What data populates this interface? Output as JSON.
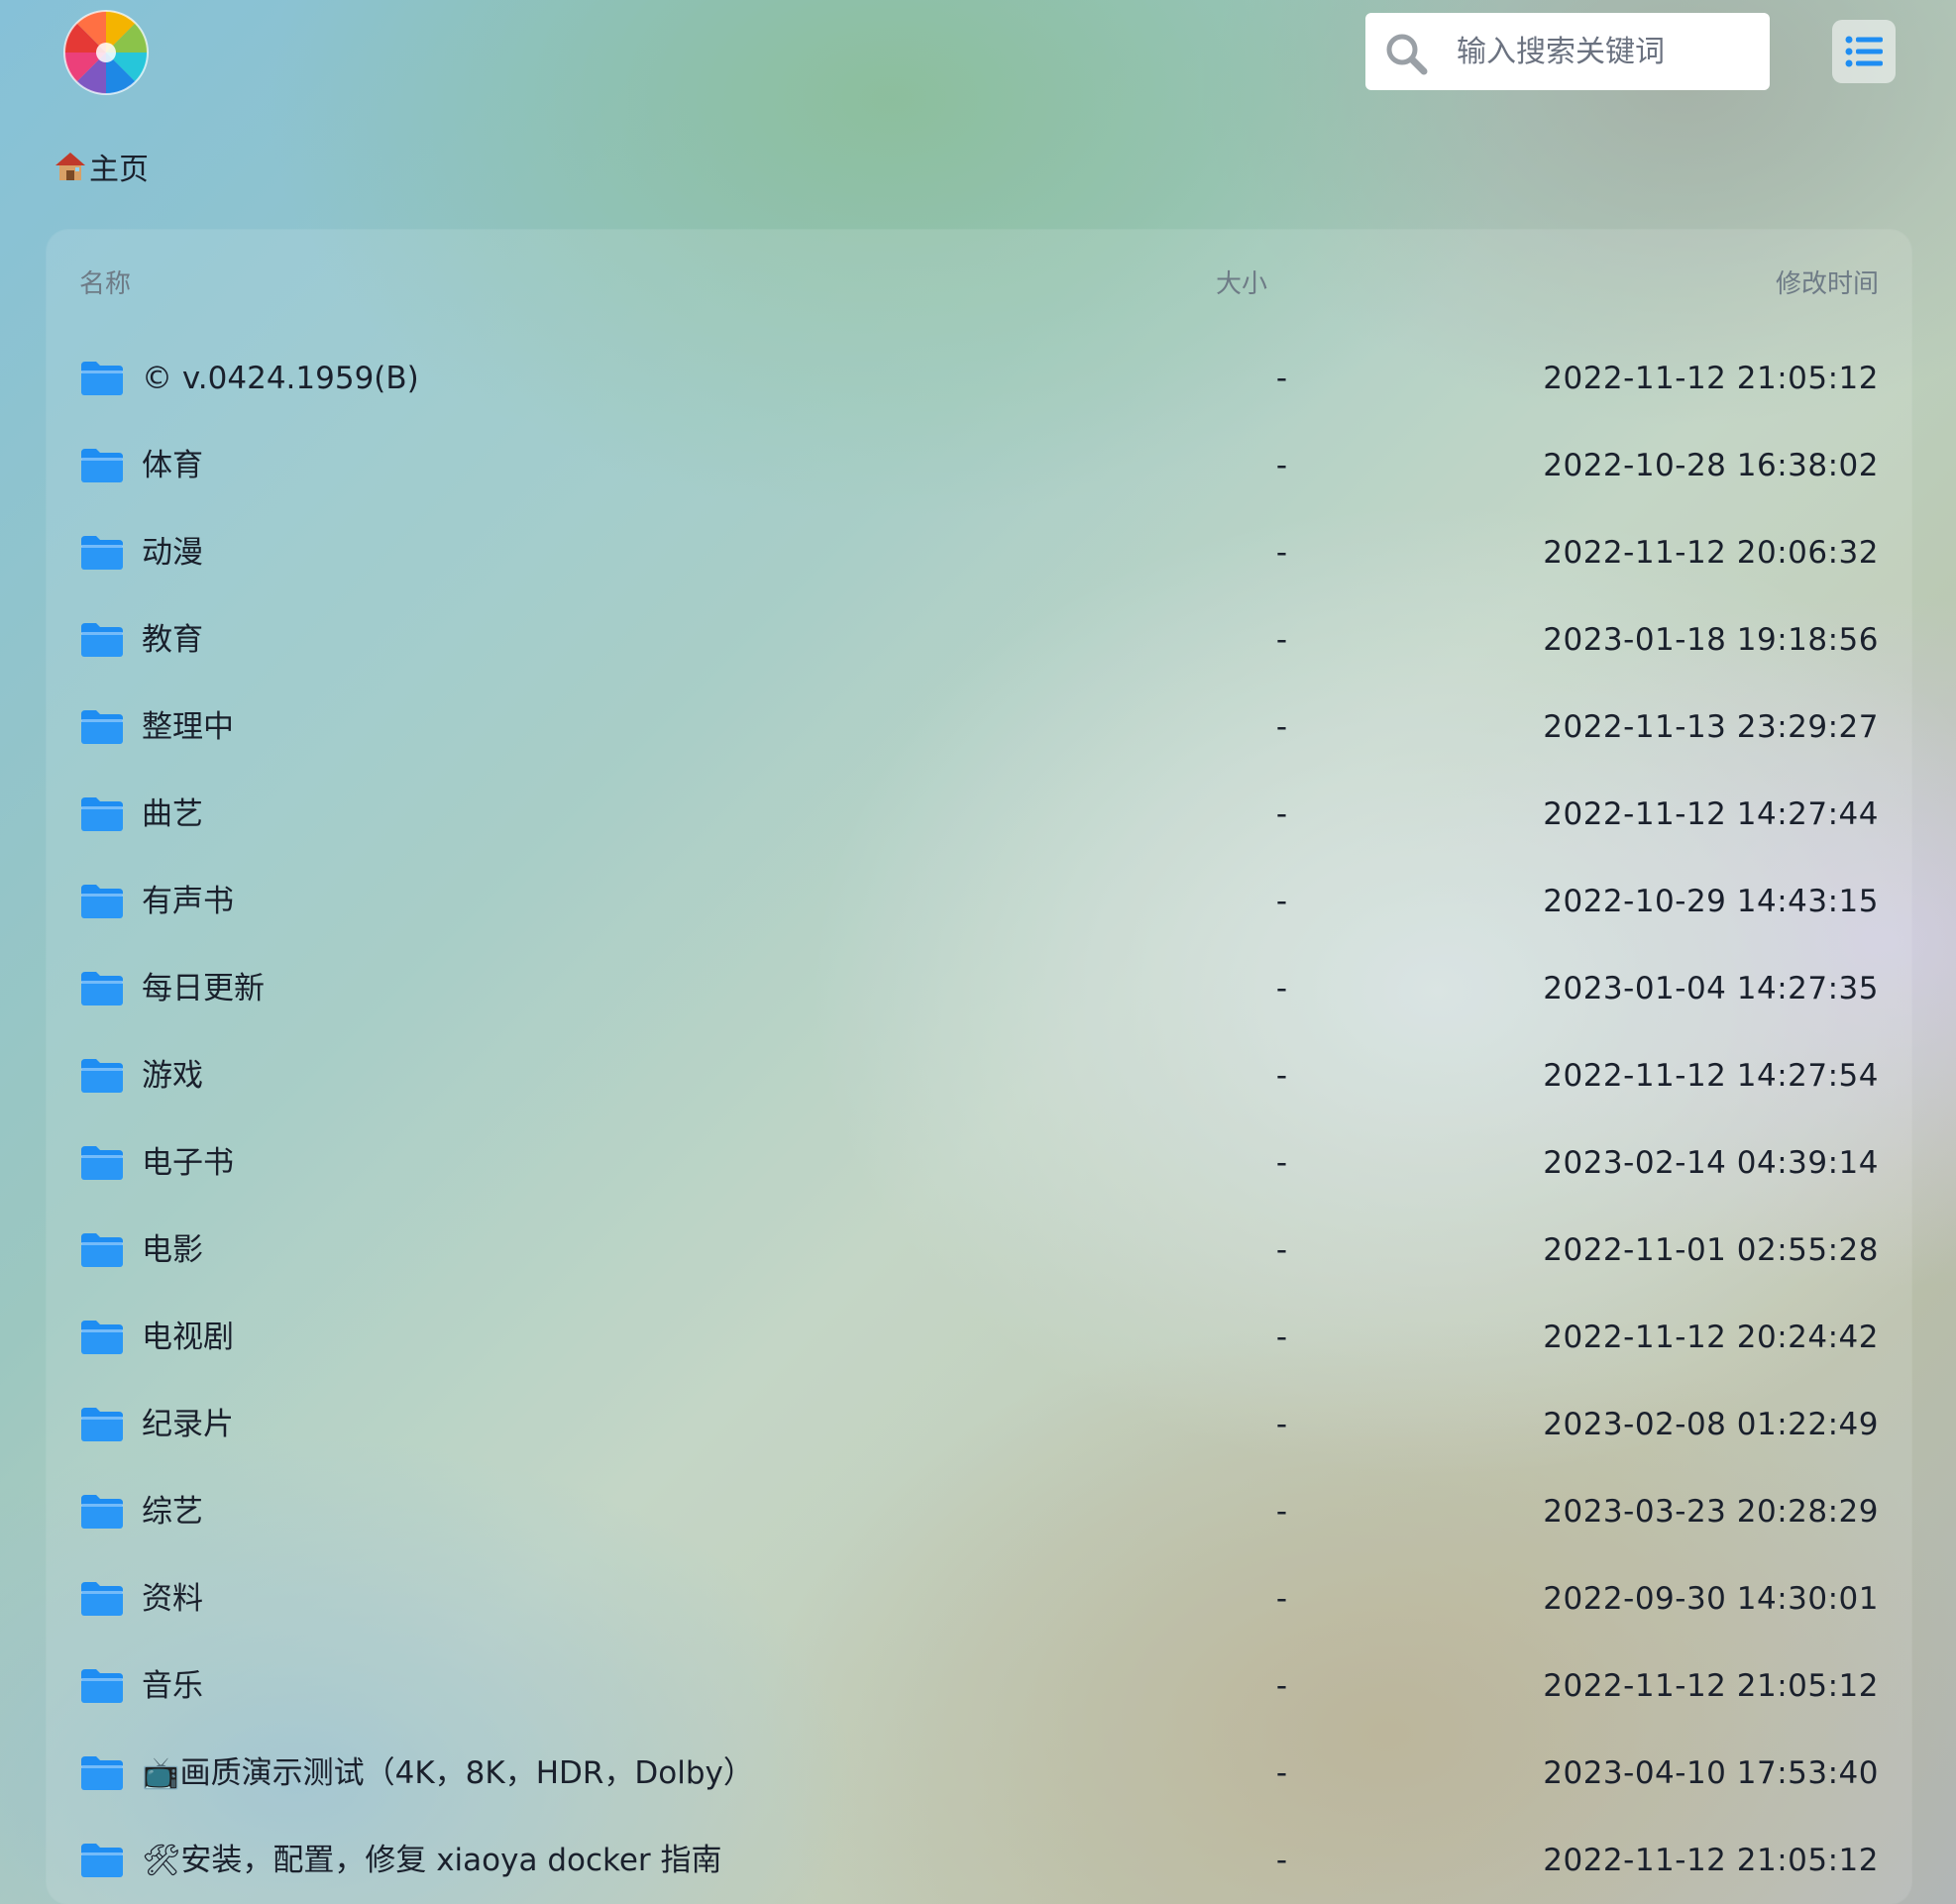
{
  "header": {
    "search": {
      "placeholder": "输入搜索关键词",
      "value": ""
    },
    "icons": {
      "logo": "color-wheel-logo",
      "search": "search-icon",
      "menu": "list-icon"
    },
    "colors": {
      "folder": "#1e8df2",
      "menu_icon": "#1e8df2"
    }
  },
  "breadcrumb": {
    "home_icon": "house-icon",
    "label": "主页"
  },
  "file_list": {
    "columns": {
      "name": "名称",
      "size": "大小",
      "modified": "修改时间"
    },
    "rows": [
      {
        "name": "© v.0424.1959(B)",
        "size": "-",
        "modified": "2022-11-12 21:05:12"
      },
      {
        "name": "体育",
        "size": "-",
        "modified": "2022-10-28 16:38:02"
      },
      {
        "name": "动漫",
        "size": "-",
        "modified": "2022-11-12 20:06:32"
      },
      {
        "name": "教育",
        "size": "-",
        "modified": "2023-01-18 19:18:56"
      },
      {
        "name": "整理中",
        "size": "-",
        "modified": "2022-11-13 23:29:27"
      },
      {
        "name": "曲艺",
        "size": "-",
        "modified": "2022-11-12 14:27:44"
      },
      {
        "name": "有声书",
        "size": "-",
        "modified": "2022-10-29 14:43:15"
      },
      {
        "name": "每日更新",
        "size": "-",
        "modified": "2023-01-04 14:27:35"
      },
      {
        "name": "游戏",
        "size": "-",
        "modified": "2022-11-12 14:27:54"
      },
      {
        "name": "电子书",
        "size": "-",
        "modified": "2023-02-14 04:39:14"
      },
      {
        "name": "电影",
        "size": "-",
        "modified": "2022-11-01 02:55:28"
      },
      {
        "name": "电视剧",
        "size": "-",
        "modified": "2022-11-12 20:24:42"
      },
      {
        "name": "纪录片",
        "size": "-",
        "modified": "2023-02-08 01:22:49"
      },
      {
        "name": "综艺",
        "size": "-",
        "modified": "2023-03-23 20:28:29"
      },
      {
        "name": "资料",
        "size": "-",
        "modified": "2022-09-30 14:30:01"
      },
      {
        "name": "音乐",
        "size": "-",
        "modified": "2022-11-12 21:05:12"
      },
      {
        "name": "📺画质演示测试（4K，8K，HDR，Dolby）",
        "size": "-",
        "modified": "2023-04-10 17:53:40"
      },
      {
        "name": "🛠安装，配置，修复 xiaoya docker 指南",
        "size": "-",
        "modified": "2022-11-12 21:05:12"
      }
    ]
  }
}
